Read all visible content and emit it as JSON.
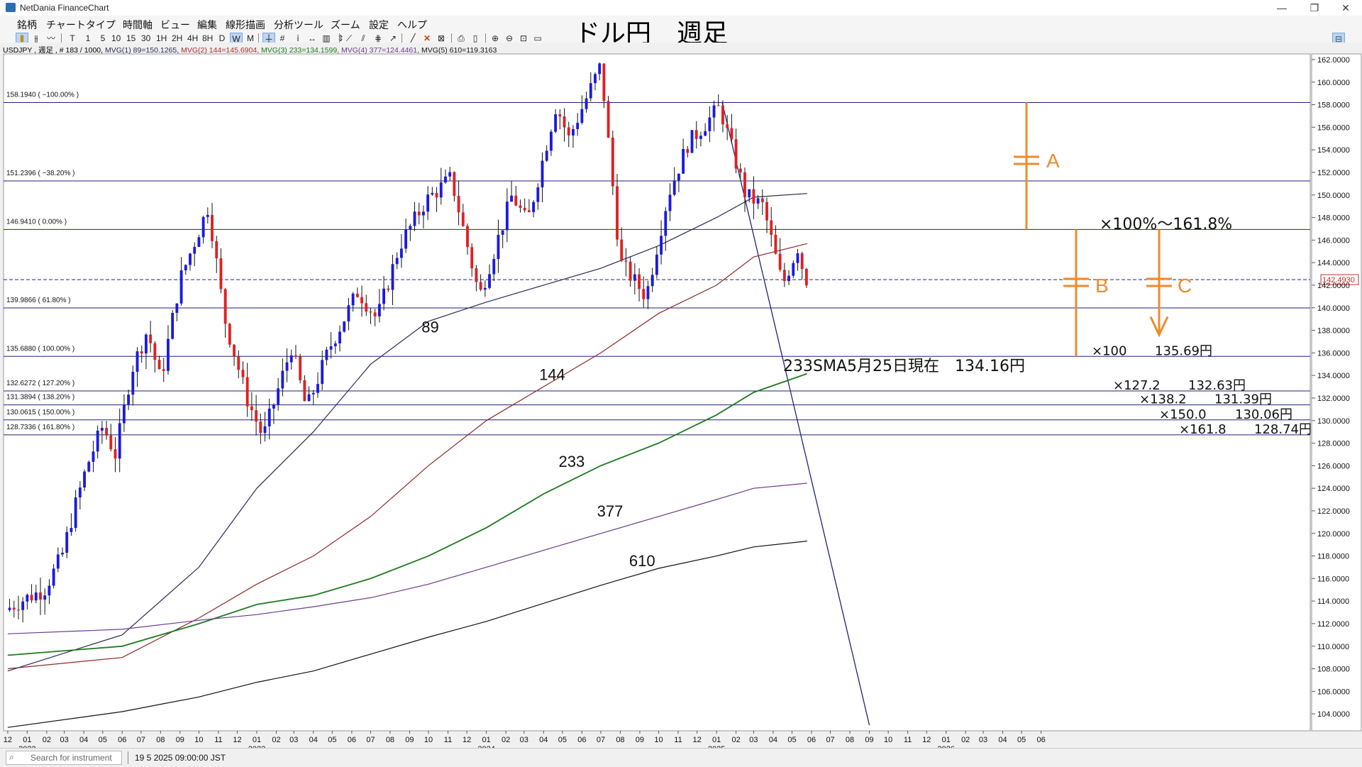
{
  "window": {
    "title": "NetDania FinanceChart",
    "min_label": "—",
    "max_label": "❐",
    "close_label": "✕"
  },
  "menu": [
    "銘柄",
    "チャートタイプ",
    "時間軸",
    "ビュー",
    "編集",
    "線形描画",
    "分析ツール",
    "ズーム",
    "設定",
    "ヘルプ"
  ],
  "toolbar": {
    "timeframes": [
      "T",
      "1",
      "5",
      "10",
      "15",
      "30",
      "1H",
      "2H",
      "4H",
      "8H",
      "D",
      "W",
      "M"
    ],
    "selected": "W"
  },
  "chart_title": "ドル円　週足",
  "info": {
    "symbol": "USDJPY , 週足 , # 183 / 1000,",
    "mv1": "MVG(1) 89=150.1265,",
    "mv2": "MVG(2) 144=145.6904,",
    "mv3": "MVG(3) 233=134.1599,",
    "mv4": "MVG(4) 377=124.4461,",
    "mv5": "MVG(5) 610=119.3163"
  },
  "status": {
    "search_placeholder": "Search for instrument",
    "time": "19 5 2025 09:00:00 JST"
  },
  "chart_data": {
    "type": "candlestick",
    "instrument": "USDJPY",
    "ylim": [
      102.5,
      162.5
    ],
    "y_ticks": [
      104,
      106,
      108,
      110,
      112,
      114,
      116,
      118,
      120,
      122,
      124,
      126,
      128,
      130,
      132,
      134,
      136,
      138,
      140,
      142,
      144,
      146,
      148,
      150,
      152,
      154,
      156,
      158,
      160,
      162
    ],
    "x_range": [
      "2021-12",
      "2026-06"
    ],
    "x_month_labels": [
      "12",
      "01",
      "02",
      "03",
      "04",
      "05",
      "06",
      "07",
      "08",
      "09",
      "10",
      "11",
      "12",
      "01",
      "02",
      "03",
      "04",
      "05",
      "06",
      "07",
      "08",
      "09",
      "10",
      "11",
      "12",
      "01",
      "02",
      "03",
      "04",
      "05",
      "06",
      "07",
      "08",
      "09",
      "10",
      "11",
      "12",
      "01",
      "02",
      "03",
      "04",
      "05",
      "06",
      "07",
      "08",
      "09",
      "10",
      "11",
      "12",
      "01",
      "02",
      "03",
      "04",
      "05",
      "06"
    ],
    "x_year_labels": [
      {
        "label": "2022",
        "month": "2022-01"
      },
      {
        "label": "2023",
        "month": "2023-01"
      },
      {
        "label": "2024",
        "month": "2024-01"
      },
      {
        "label": "2025",
        "month": "2025-01"
      },
      {
        "label": "2026",
        "month": "2026-01"
      }
    ],
    "current_price": "142.4930",
    "current_price_value": 142.493,
    "price_path": [
      {
        "date": "2021-12-01",
        "price": 113.2
      },
      {
        "date": "2022-01-01",
        "price": 114.2
      },
      {
        "date": "2022-02-01",
        "price": 115.0
      },
      {
        "date": "2022-03-01",
        "price": 118.0
      },
      {
        "date": "2022-03-20",
        "price": 122.0
      },
      {
        "date": "2022-04-10",
        "price": 126.0
      },
      {
        "date": "2022-05-05",
        "price": 129.5
      },
      {
        "date": "2022-05-25",
        "price": 127.0
      },
      {
        "date": "2022-06-20",
        "price": 134.5
      },
      {
        "date": "2022-07-15",
        "price": 138.0
      },
      {
        "date": "2022-08-05",
        "price": 133.5
      },
      {
        "date": "2022-09-05",
        "price": 142.5
      },
      {
        "date": "2022-10-20",
        "price": 149.0
      },
      {
        "date": "2022-11-15",
        "price": 139.0
      },
      {
        "date": "2022-12-20",
        "price": 132.0
      },
      {
        "date": "2023-01-15",
        "price": 128.5
      },
      {
        "date": "2023-03-01",
        "price": 136.5
      },
      {
        "date": "2023-03-25",
        "price": 131.0
      },
      {
        "date": "2023-05-01",
        "price": 136.5
      },
      {
        "date": "2023-06-15",
        "price": 141.5
      },
      {
        "date": "2023-07-15",
        "price": 139.0
      },
      {
        "date": "2023-08-20",
        "price": 145.5
      },
      {
        "date": "2023-10-01",
        "price": 149.5
      },
      {
        "date": "2023-11-10",
        "price": 151.5
      },
      {
        "date": "2023-12-25",
        "price": 141.0
      },
      {
        "date": "2024-02-15",
        "price": 150.0
      },
      {
        "date": "2024-03-10",
        "price": 147.5
      },
      {
        "date": "2024-04-25",
        "price": 158.0
      },
      {
        "date": "2024-05-15",
        "price": 155.0
      },
      {
        "date": "2024-07-05",
        "price": 161.5
      },
      {
        "date": "2024-08-05",
        "price": 144.0
      },
      {
        "date": "2024-09-15",
        "price": 141.0
      },
      {
        "date": "2024-10-20",
        "price": 150.0
      },
      {
        "date": "2024-11-20",
        "price": 154.5
      },
      {
        "date": "2025-01-10",
        "price": 157.8
      },
      {
        "date": "2025-02-20",
        "price": 150.0
      },
      {
        "date": "2025-03-20",
        "price": 149.0
      },
      {
        "date": "2025-04-20",
        "price": 142.0
      },
      {
        "date": "2025-05-15",
        "price": 145.5
      },
      {
        "date": "2025-05-25",
        "price": 142.5
      }
    ],
    "moving_averages": [
      {
        "label": "89",
        "color": "#2a2a55",
        "points": [
          {
            "date": "2021-12-01",
            "value": 107.8
          },
          {
            "date": "2022-06-01",
            "value": 111.0
          },
          {
            "date": "2022-10-01",
            "value": 117.0
          },
          {
            "date": "2023-01-01",
            "value": 124.0
          },
          {
            "date": "2023-04-01",
            "value": 129.0
          },
          {
            "date": "2023-07-01",
            "value": 135.0
          },
          {
            "date": "2023-10-01",
            "value": 138.8
          },
          {
            "date": "2024-01-01",
            "value": 140.5
          },
          {
            "date": "2024-04-01",
            "value": 142.0
          },
          {
            "date": "2024-07-01",
            "value": 143.5
          },
          {
            "date": "2024-10-01",
            "value": 145.5
          },
          {
            "date": "2025-01-01",
            "value": 148.0
          },
          {
            "date": "2025-03-01",
            "value": 149.8
          },
          {
            "date": "2025-05-25",
            "value": 150.13
          }
        ]
      },
      {
        "label": "144",
        "color": "#8b2a2a",
        "points": [
          {
            "date": "2021-12-01",
            "value": 108.0
          },
          {
            "date": "2022-06-01",
            "value": 109.0
          },
          {
            "date": "2022-10-01",
            "value": 112.5
          },
          {
            "date": "2023-01-01",
            "value": 115.5
          },
          {
            "date": "2023-04-01",
            "value": 118.0
          },
          {
            "date": "2023-07-01",
            "value": 121.5
          },
          {
            "date": "2023-10-01",
            "value": 126.0
          },
          {
            "date": "2024-01-01",
            "value": 130.0
          },
          {
            "date": "2024-04-01",
            "value": 133.0
          },
          {
            "date": "2024-07-01",
            "value": 136.0
          },
          {
            "date": "2024-10-01",
            "value": 139.5
          },
          {
            "date": "2025-01-01",
            "value": 142.0
          },
          {
            "date": "2025-03-01",
            "value": 144.5
          },
          {
            "date": "2025-05-25",
            "value": 145.69
          }
        ]
      },
      {
        "label": "233",
        "color": "#1f7a1f",
        "points": [
          {
            "date": "2021-12-01",
            "value": 109.2
          },
          {
            "date": "2022-06-01",
            "value": 110.0
          },
          {
            "date": "2022-10-01",
            "value": 112.0
          },
          {
            "date": "2023-01-01",
            "value": 113.7
          },
          {
            "date": "2023-04-01",
            "value": 114.5
          },
          {
            "date": "2023-07-01",
            "value": 116.0
          },
          {
            "date": "2023-10-01",
            "value": 118.0
          },
          {
            "date": "2024-01-01",
            "value": 120.5
          },
          {
            "date": "2024-04-01",
            "value": 123.5
          },
          {
            "date": "2024-07-01",
            "value": 126.0
          },
          {
            "date": "2024-10-01",
            "value": 128.0
          },
          {
            "date": "2025-01-01",
            "value": 130.5
          },
          {
            "date": "2025-03-01",
            "value": 132.5
          },
          {
            "date": "2025-05-25",
            "value": 134.16
          }
        ]
      },
      {
        "label": "377",
        "color": "#6a3a8a",
        "points": [
          {
            "date": "2021-12-01",
            "value": 111.1
          },
          {
            "date": "2022-06-01",
            "value": 111.5
          },
          {
            "date": "2022-10-01",
            "value": 112.3
          },
          {
            "date": "2023-01-01",
            "value": 112.8
          },
          {
            "date": "2023-04-01",
            "value": 113.5
          },
          {
            "date": "2023-07-01",
            "value": 114.3
          },
          {
            "date": "2023-10-01",
            "value": 115.5
          },
          {
            "date": "2024-01-01",
            "value": 117.0
          },
          {
            "date": "2024-04-01",
            "value": 118.5
          },
          {
            "date": "2024-07-01",
            "value": 120.0
          },
          {
            "date": "2024-10-01",
            "value": 121.5
          },
          {
            "date": "2025-01-01",
            "value": 123.0
          },
          {
            "date": "2025-03-01",
            "value": 124.0
          },
          {
            "date": "2025-05-25",
            "value": 124.45
          }
        ]
      },
      {
        "label": "610",
        "color": "#111111",
        "points": [
          {
            "date": "2021-12-01",
            "value": 102.8
          },
          {
            "date": "2022-06-01",
            "value": 104.2
          },
          {
            "date": "2022-10-01",
            "value": 105.5
          },
          {
            "date": "2023-01-01",
            "value": 106.8
          },
          {
            "date": "2023-04-01",
            "value": 107.8
          },
          {
            "date": "2023-07-01",
            "value": 109.3
          },
          {
            "date": "2023-10-01",
            "value": 110.8
          },
          {
            "date": "2024-01-01",
            "value": 112.2
          },
          {
            "date": "2024-04-01",
            "value": 113.8
          },
          {
            "date": "2024-07-01",
            "value": 115.4
          },
          {
            "date": "2024-10-01",
            "value": 116.9
          },
          {
            "date": "2025-01-01",
            "value": 118.0
          },
          {
            "date": "2025-03-01",
            "value": 118.8
          },
          {
            "date": "2025-05-25",
            "value": 119.32
          }
        ]
      }
    ],
    "fib_levels": [
      {
        "label": "158.1940 ( −100.00% )",
        "value": 158.194
      },
      {
        "label": "151.2396 ( −38.20% )",
        "value": 151.2396
      },
      {
        "label": "146.9410 ( 0.00% )",
        "value": 146.941
      },
      {
        "label": "139.9866 ( 61.80% )",
        "value": 139.9866
      },
      {
        "label": "135.6880 ( 100.00% )",
        "value": 135.688
      },
      {
        "label": "132.6272 ( 127.20% )",
        "value": 132.6272
      },
      {
        "label": "131.3894 ( 138.20% )",
        "value": 131.3894
      },
      {
        "label": "130.0615 ( 150.00% )",
        "value": 130.0615
      },
      {
        "label": "128.7336 ( 161.80% )",
        "value": 128.7336
      }
    ],
    "trend_line": [
      {
        "date": "2025-01-10",
        "value": 158.2
      },
      {
        "date": "2025-09-01",
        "value": 103.0
      }
    ],
    "annotations": {
      "ma_labels": [
        {
          "text": "89",
          "date": "2023-09-20",
          "value": 137.8
        },
        {
          "text": "144",
          "date": "2024-03-25",
          "value": 133.6
        },
        {
          "text": "233",
          "date": "2024-04-25",
          "value": 125.9
        },
        {
          "text": "377",
          "date": "2024-06-25",
          "value": 121.5
        },
        {
          "text": "610",
          "date": "2024-08-15",
          "value": 117.1
        }
      ],
      "sma_note": "233SMA5月25日現在　134.16円",
      "range_label": "×100%〜161.8%",
      "markers": [
        "A",
        "B",
        "C"
      ],
      "targets": [
        {
          "mult": "×100",
          "price": "135.69円",
          "value": 135.69
        },
        {
          "mult": "×127.2",
          "price": "132.63円",
          "value": 132.63
        },
        {
          "mult": "×138.2",
          "price": "131.39円",
          "value": 131.39
        },
        {
          "mult": "×150.0",
          "price": "130.06円",
          "value": 130.06
        },
        {
          "mult": "×161.8",
          "price": "128.74円",
          "value": 128.74
        }
      ],
      "accent_color": "#f08a2c"
    },
    "grid": false
  }
}
